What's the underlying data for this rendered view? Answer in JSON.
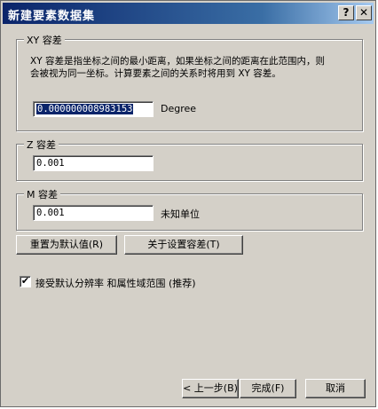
{
  "window": {
    "title": "新建要素数据集",
    "help_label": "?",
    "close_label": "✕"
  },
  "xy_group": {
    "legend": "XY 容差",
    "description": "XY 容差是指坐标之间的最小距离，如果坐标之间的距离在此范围内，则会被视为同一坐标。计算要素之间的关系时将用到 XY 容差。",
    "value": "0.000000008983153",
    "unit": "Degree"
  },
  "z_group": {
    "legend": "Z 容差",
    "value": "0.001"
  },
  "m_group": {
    "legend": "M 容差",
    "value": "0.001",
    "unit": "未知单位"
  },
  "buttons": {
    "reset": "重置为默认值(R)",
    "about": "关于设置容差(T)",
    "back": "< 上一步(B)",
    "finish": "完成(F)",
    "cancel": "取消"
  },
  "accept_default": {
    "checked": true,
    "check_mark": "✔",
    "label": "接受默认分辨率 和属性域范围 (推荐)"
  }
}
